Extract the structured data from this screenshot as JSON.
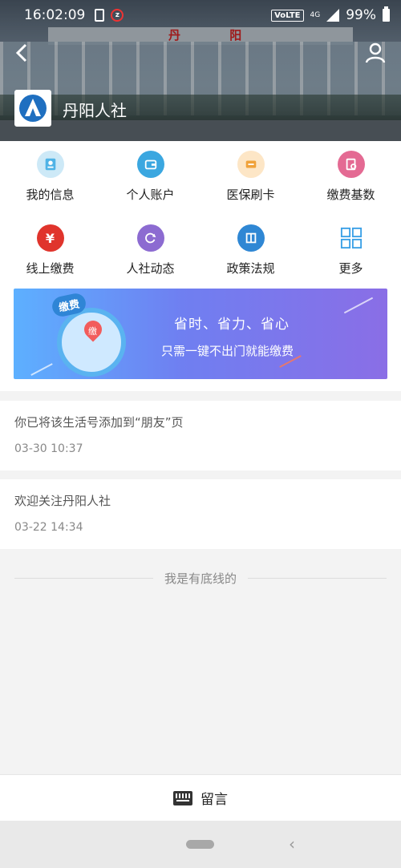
{
  "status_bar": {
    "time": "16:02:09",
    "volte": "VoLTE",
    "network": "4G",
    "battery": "99%"
  },
  "header": {
    "org_name": "丹阳人社",
    "building_sign": "丹 阳"
  },
  "grid": {
    "items": [
      {
        "label": "我的信息",
        "icon": "id-card-icon",
        "color": "#4fb3e6",
        "bg": "#cde9f7"
      },
      {
        "label": "个人账户",
        "icon": "wallet-icon",
        "color": "#3ba7e0",
        "bg": "#c9e6f6"
      },
      {
        "label": "医保刷卡",
        "icon": "card-icon",
        "color": "#f0a23a",
        "bg": "#fde6c6"
      },
      {
        "label": "缴费基数",
        "icon": "invoice-icon",
        "color": "#e46a93",
        "bg": "#f7cddd"
      },
      {
        "label": "线上缴费",
        "icon": "yen-icon",
        "color": "#ffffff",
        "bg": "#e0342c"
      },
      {
        "label": "人社动态",
        "icon": "refresh-icon",
        "color": "#ffffff",
        "bg": "#8c6bd1"
      },
      {
        "label": "政策法规",
        "icon": "book-icon",
        "color": "#ffffff",
        "bg": "#2f87d4"
      },
      {
        "label": "更多",
        "icon": "grid-icon",
        "color": "#3aa0e6",
        "bg": "transparent"
      }
    ]
  },
  "banner": {
    "tag": "缴费",
    "coin_char": "缴",
    "line1": "省时、省力、省心",
    "line2": "只需一键不出门就能缴费"
  },
  "messages": [
    {
      "title": "你已将该生活号添加到“朋友”页",
      "time": "03-30 10:37"
    },
    {
      "title": "欢迎关注丹阳人社",
      "time": "03-22 14:34"
    }
  ],
  "end_text": "我是有底线的",
  "bottom_bar": {
    "label": "留言"
  },
  "nav_bar": {
    "back_glyph": "‹"
  }
}
